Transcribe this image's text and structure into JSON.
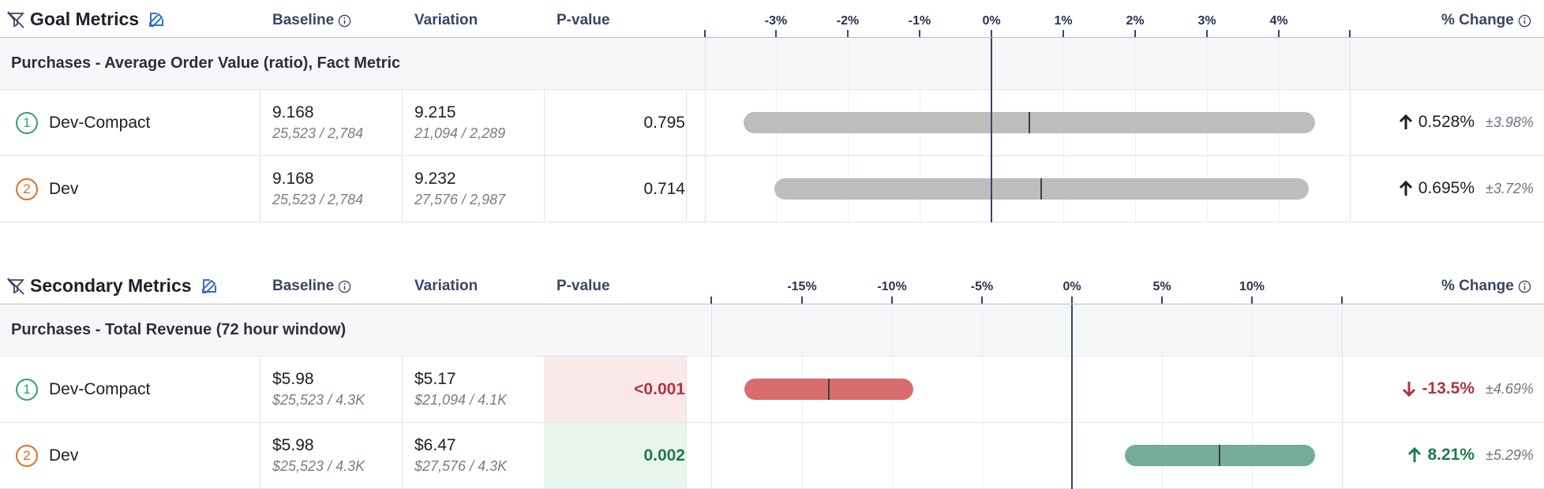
{
  "goal": {
    "title": "Goal Metrics",
    "columns": {
      "baseline": "Baseline",
      "variation": "Variation",
      "pvalue": "P-value",
      "change": "% Change"
    },
    "axis_ticks": [
      "-3%",
      "-2%",
      "-1%",
      "0%",
      "1%",
      "2%",
      "3%",
      "4%"
    ],
    "metric_name": "Purchases - Average Order Value (ratio), Fact Metric",
    "rows": [
      {
        "badge": "1",
        "name": "Dev-Compact",
        "baseline": "9.168",
        "baseline_sub": "25,523 / 2,784",
        "variation": "9.215",
        "variation_sub": "21,094 / 2,289",
        "pvalue": "0.795",
        "change": "0.528%",
        "ci": "±3.98%",
        "direction": "up",
        "center_pct": 0.528,
        "half_width_pct": 3.98
      },
      {
        "badge": "2",
        "name": "Dev",
        "baseline": "9.168",
        "baseline_sub": "25,523 / 2,784",
        "variation": "9.232",
        "variation_sub": "27,576 / 2,987",
        "pvalue": "0.714",
        "change": "0.695%",
        "ci": "±3.72%",
        "direction": "up",
        "center_pct": 0.695,
        "half_width_pct": 3.72
      }
    ]
  },
  "secondary": {
    "title": "Secondary Metrics",
    "columns": {
      "baseline": "Baseline",
      "variation": "Variation",
      "pvalue": "P-value",
      "change": "% Change"
    },
    "axis_ticks": [
      "-15%",
      "-10%",
      "-5%",
      "0%",
      "5%",
      "10%"
    ],
    "metric_name": "Purchases - Total Revenue (72 hour window)",
    "rows": [
      {
        "badge": "1",
        "name": "Dev-Compact",
        "baseline": "$5.98",
        "baseline_sub": "$25,523 / 4.3K",
        "variation": "$5.17",
        "variation_sub": "$21,094 / 4.1K",
        "pvalue": "<0.001",
        "change": "-13.5%",
        "ci": "±4.69%",
        "direction": "down",
        "center_pct": -13.5,
        "half_width_pct": 4.69
      },
      {
        "badge": "2",
        "name": "Dev",
        "baseline": "$5.98",
        "baseline_sub": "$25,523 / 4.3K",
        "variation": "$6.47",
        "variation_sub": "$27,576 / 4.3K",
        "pvalue": "0.002",
        "change": "8.21%",
        "ci": "±5.29%",
        "direction": "up",
        "center_pct": 8.21,
        "half_width_pct": 5.29
      }
    ]
  },
  "colors": {
    "neutral_bar": "#bdbdbd",
    "loss_bar": "#d96c6c",
    "win_bar": "#74ad98",
    "loss_text": "#b3343c",
    "win_text": "#1f7a4f",
    "loss_cell": "#fbe9e9",
    "win_cell": "#e8f5ec"
  }
}
